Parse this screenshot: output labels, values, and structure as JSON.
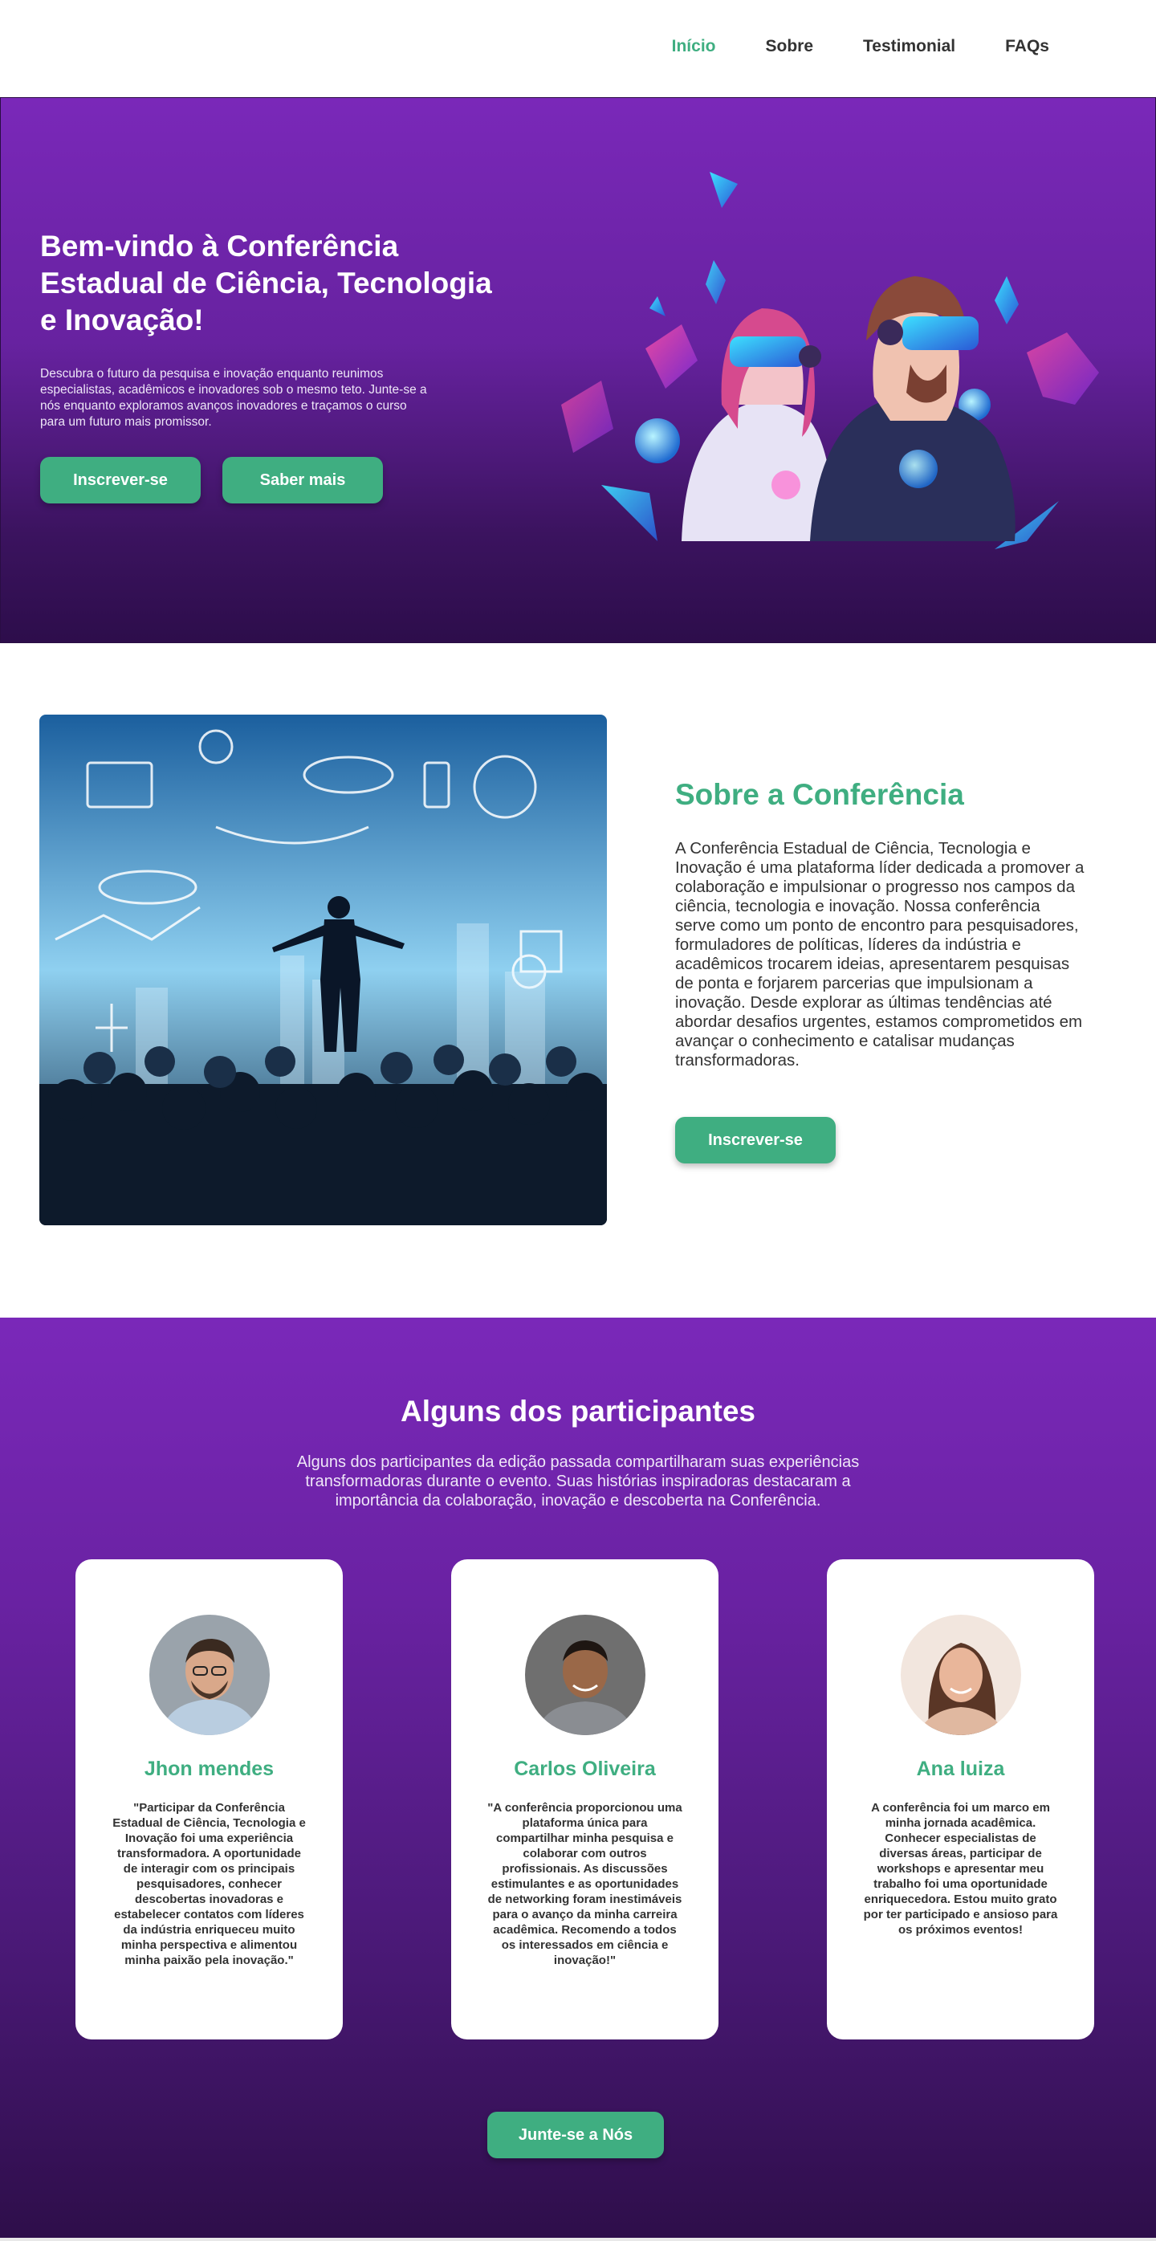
{
  "nav": {
    "items": [
      {
        "label": "Início",
        "active": true
      },
      {
        "label": "Sobre",
        "active": false
      },
      {
        "label": "Testimonial",
        "active": false
      },
      {
        "label": "FAQs",
        "active": false
      }
    ]
  },
  "hero": {
    "title": "Bem-vindo à Conferência Estadual de Ciência, Tecnologia e Inovação!",
    "description": "Descubra o futuro da pesquisa e inovação enquanto reunimos especialistas, acadêmicos e inovadores sob o mesmo teto. Junte-se a nós enquanto exploramos avanços inovadores e traçamos o curso para um futuro mais promissor.",
    "primary_button": "Inscrever-se",
    "secondary_button": "Saber mais"
  },
  "about": {
    "title": "Sobre a Conferência",
    "description": "A Conferência Estadual de Ciência, Tecnologia e Inovação é uma plataforma líder dedicada a promover a colaboração e impulsionar o progresso nos campos da ciência, tecnologia e inovação. Nossa conferência serve como um ponto de encontro para pesquisadores, formuladores de políticas, líderes da indústria e acadêmicos trocarem ideias, apresentarem pesquisas de ponta e forjarem parcerias que impulsionam a inovação. Desde explorar as últimas tendências até abordar desafios urgentes, estamos comprometidos em avançar o conhecimento e catalisar mudanças transformadoras.",
    "button": "Inscrever-se"
  },
  "participants": {
    "title": "Alguns dos participantes",
    "description": "Alguns dos participantes da edição passada compartilharam suas experiências transformadoras durante o evento. Suas histórias inspiradoras destacaram a importância da colaboração, inovação e descoberta na Conferência.",
    "cards": [
      {
        "name": "Jhon mendes",
        "quote": "\"Participar da Conferência Estadual de Ciência, Tecnologia e Inovação foi uma experiência transformadora. A oportunidade de interagir com os principais pesquisadores, conhecer descobertas inovadoras e estabelecer contatos com líderes da indústria enriqueceu muito minha perspectiva e alimentou minha paixão pela inovação.\""
      },
      {
        "name": "Carlos Oliveira",
        "quote": "\"A conferência proporcionou uma plataforma única para compartilhar minha pesquisa e colaborar com outros profissionais. As discussões estimulantes e as oportunidades de networking foram inestimáveis para o avanço da minha carreira acadêmica. Recomendo a todos os interessados em ciência e inovação!\""
      },
      {
        "name": "Ana luiza",
        "quote": "A conferência foi um marco em minha jornada acadêmica. Conhecer especialistas de diversas áreas, participar de workshops e apresentar meu trabalho foi uma oportunidade enriquecedora. Estou muito grato por ter participado e ansioso para os próximos eventos!"
      }
    ],
    "button": "Junte-se a Nós"
  },
  "colors": {
    "accent": "#3fae81",
    "purple_top": "#7a28b9",
    "purple_bottom": "#2d0d4b"
  }
}
